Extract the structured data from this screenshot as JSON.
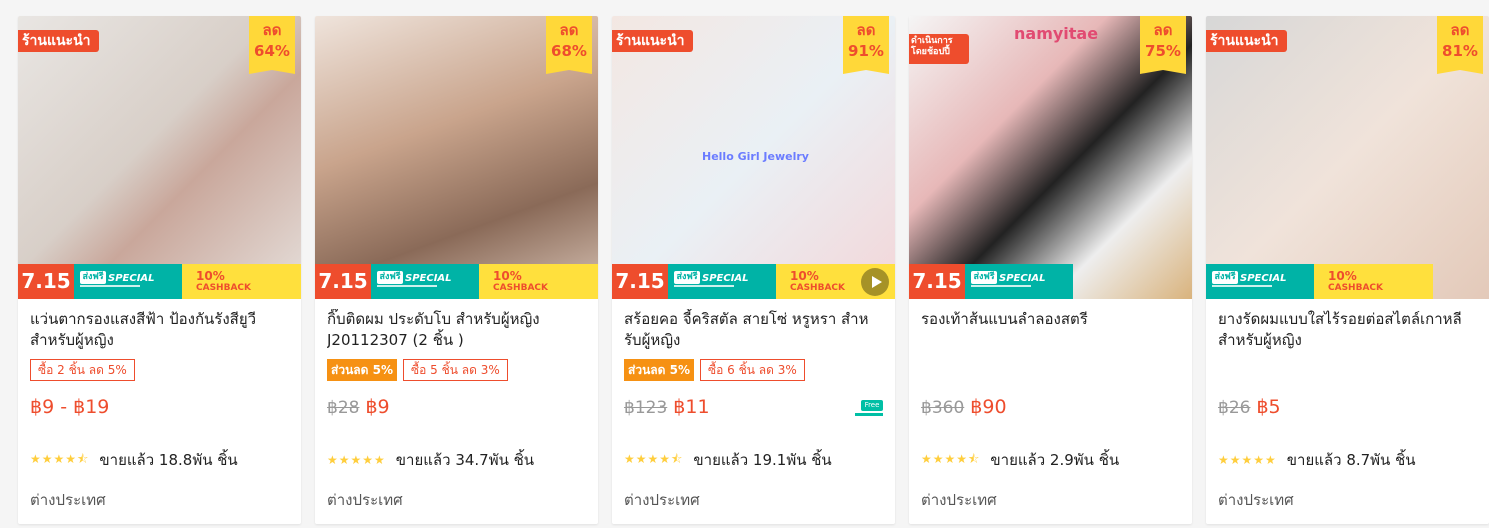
{
  "labels": {
    "recommended": "ร้านแนะนำ",
    "managed": "ดำเนินการโดยช้อปปี้",
    "discount": "ลด",
    "event": "7.15",
    "free_ship": "ส่งฟรี",
    "special": "SPECIAL",
    "cashback_pct": "10%",
    "cashback": "CASHBACK",
    "free": "Free",
    "location": "ต่างประเทศ"
  },
  "colors": {
    "accent": "#ee4d2d",
    "badge_yellow": "#ffd839",
    "teal": "#00b3a6",
    "orange": "#f69113",
    "star": "#ffce3d"
  },
  "products": [
    {
      "title": "แว่นตากรองแสงสีฟ้า ป้องกันรังสียูวี สำหรับผู้หญิง",
      "discount": "64%",
      "badge": "recommended",
      "tags": [
        {
          "type": "outline",
          "text": "ซื้อ 2 ชิ้น ลด 5%"
        }
      ],
      "old_price": "",
      "price": "฿9 - ฿19",
      "rating": 4.5,
      "sold": "ขายแล้ว 18.8พัน ชิ้น",
      "location": "ต่างประเทศ"
    },
    {
      "title": "กิ๊บติดผม ประดับโบ สําหรับผู้หญิง J20112307 (2 ชิ้น )",
      "discount": "68%",
      "badge": "",
      "tags": [
        {
          "type": "fill",
          "text": "ส่วนลด 5%"
        },
        {
          "type": "outline",
          "text": "ซื้อ 5 ชิ้น ลด 3%"
        }
      ],
      "old_price": "฿28",
      "price": "฿9",
      "rating": 5,
      "sold": "ขายแล้ว 34.7พัน ชิ้น",
      "location": "ต่างประเทศ"
    },
    {
      "title": "สร้อยคอ จี้คริสตัล สายโซ่ หรูหรา สําหรับผู้หญิง",
      "discount": "91%",
      "badge": "recommended",
      "tags": [
        {
          "type": "fill",
          "text": "ส่วนลด 5%"
        },
        {
          "type": "outline",
          "text": "ซื้อ 6 ชิ้น ลด 3%"
        }
      ],
      "old_price": "฿123",
      "price": "฿11",
      "rating": 4.5,
      "sold": "ขายแล้ว 19.1พัน ชิ้น",
      "location": "ต่างประเทศ",
      "image_text": "Hello Girl Jewelry",
      "video": true,
      "free_ship_icon": true
    },
    {
      "title": "รองเท้าส้นแบนลําลองสตรี",
      "discount": "75%",
      "badge": "managed",
      "tags": [],
      "old_price": "฿360",
      "price": "฿90",
      "rating": 4.5,
      "sold": "ขายแล้ว 2.9พัน ชิ้น",
      "location": "ต่างประเทศ",
      "image_text": "namyitae",
      "no_cashback": true
    },
    {
      "title": "ยางรัดผมแบบใสไร้รอยต่อสไตล์เกาหลีสําหรับผู้หญิง",
      "discount": "81%",
      "badge": "recommended",
      "tags": [],
      "old_price": "฿26",
      "price": "฿5",
      "rating": 5,
      "sold": "ขายแล้ว 8.7พัน ชิ้น",
      "location": "ต่างประเทศ",
      "no_event": true
    }
  ]
}
